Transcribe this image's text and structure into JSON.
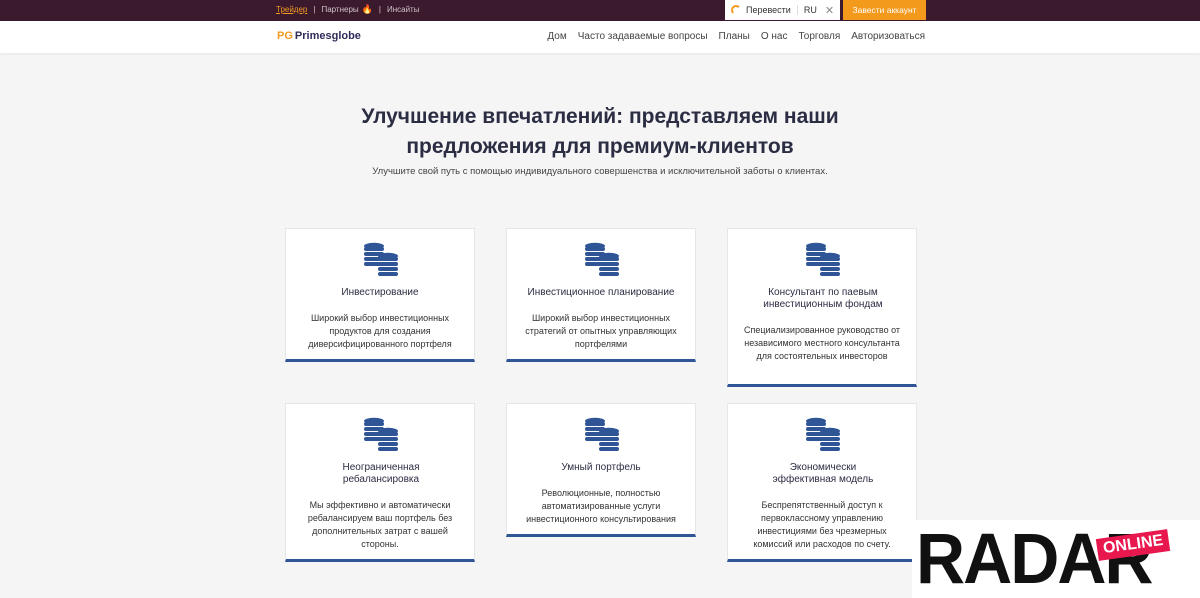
{
  "topbar": {
    "links": [
      "Трейдер",
      "Партнеры",
      "Инсайты"
    ],
    "translate_label": "Перевести",
    "lang": "RU",
    "cta": "Завести аккаунт"
  },
  "header": {
    "logo": "Primesglobe",
    "logo_mark": "PG",
    "nav": [
      "Дом",
      "Часто задаваемые вопросы",
      "Планы",
      "О нас",
      "Торговля",
      "Авторизоваться"
    ]
  },
  "hero": {
    "title_line1": "Улучшение впечатлений: представляем наши",
    "title_line2": "предложения для премиум-клиентов",
    "subtitle": "Улучшите свой путь с помощью индивидуального совершенства и исключительной заботы о клиентах."
  },
  "cards": [
    {
      "title": "Инвестирование",
      "desc": "Широкий выбор инвестиционных продуктов для создания диверсифицированного портфеля"
    },
    {
      "title": "Инвестиционное планирование",
      "desc": "Широкий выбор инвестиционных стратегий от опытных управляющих портфелями"
    },
    {
      "title": "Консультант по паевым инвестиционным фондам",
      "desc": "Специализированное руководство от независимого местного консультанта для состоятельных инвесторов"
    },
    {
      "title": "Неограниченная ребалансировка",
      "desc": "Мы эффективно и автоматически ребалансируем ваш портфель без дополнительных затрат с вашей стороны."
    },
    {
      "title": "Умный портфель",
      "desc": "Революционные, полностью автоматизированные услуги инвестиционного консультирования"
    },
    {
      "title": "Экономически эффективная модель",
      "desc": "Беспрепятственный доступ к первоклассному управлению инвестициями без чрезмерных комиссий или расходов по счету."
    }
  ],
  "watermark": {
    "word": "RADAR",
    "tag": "ONLINE"
  },
  "colors": {
    "accent": "#f39a1c",
    "topbar": "#3b1a2e",
    "card_border": "#2f5597"
  }
}
